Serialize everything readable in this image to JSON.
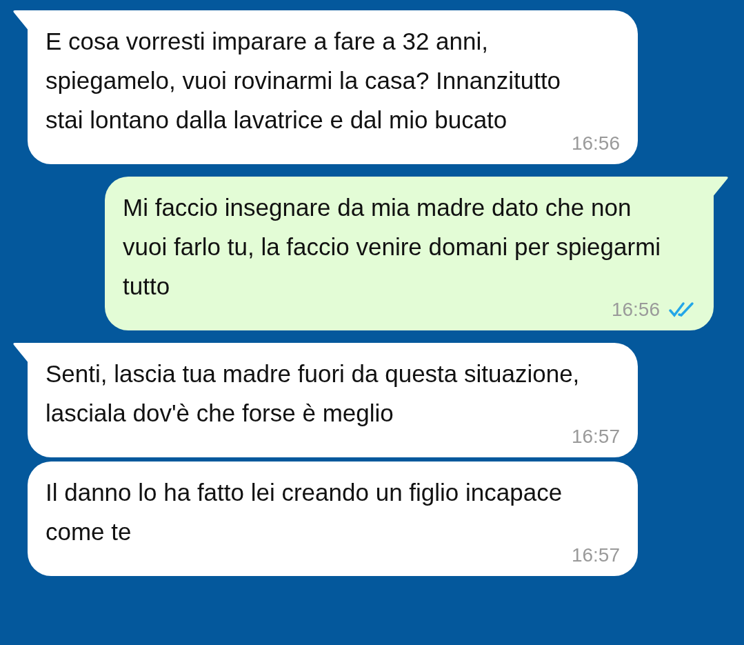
{
  "messages": [
    {
      "kind": "incoming",
      "tail": true,
      "text": "E cosa vorresti imparare a fare a 32 anni, spiegamelo, vuoi rovinarmi la casa? Innanzitutto stai lontano dalla lavatrice e dal mio bucato",
      "time": "16:56"
    },
    {
      "kind": "outgoing",
      "tail": true,
      "read": true,
      "text": "Mi faccio insegnare da mia madre dato che non vuoi farlo tu, la faccio venire domani per spiegarmi tutto",
      "time": "16:56"
    },
    {
      "kind": "incoming",
      "tail": true,
      "text": "Senti, lascia tua madre fuori da questa situazione, lasciala dov'è che forse è meglio",
      "time": "16:57"
    },
    {
      "kind": "incoming",
      "tail": false,
      "text": "Il danno lo ha fatto lei creando un figlio incapace come te",
      "time": "16:57"
    }
  ]
}
